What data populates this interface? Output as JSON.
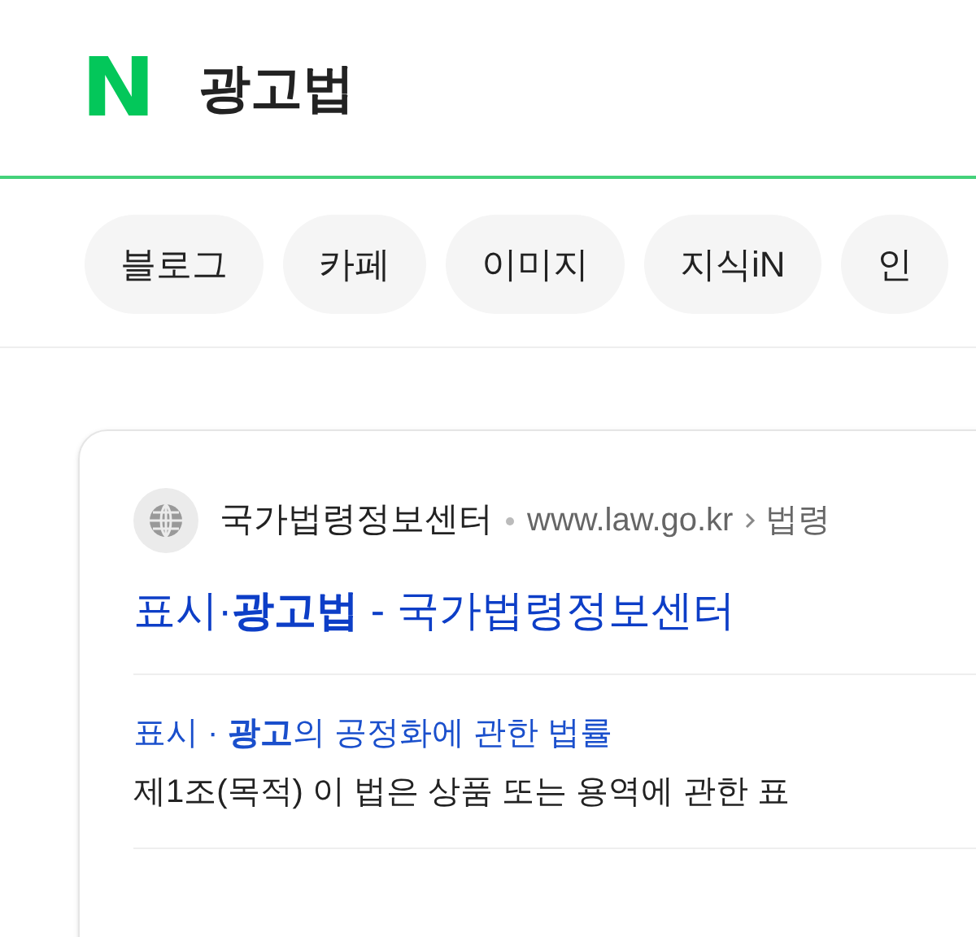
{
  "header": {
    "logo": "N",
    "query": "광고법"
  },
  "tabs": [
    {
      "label": "블로그",
      "selected": false
    },
    {
      "label": "카페",
      "selected": false
    },
    {
      "label": "이미지",
      "selected": false
    },
    {
      "label": "지식iN",
      "selected": false
    },
    {
      "label": "인",
      "selected": false
    }
  ],
  "result": {
    "site_name": "국가법령정보센터",
    "url": "www.law.go.kr",
    "breadcrumb": "법령",
    "title": "표시·**광고법** - 국가법령정보센터",
    "subtitle": "표시 · **광고**의 공정화에 관한 법률",
    "snippet": "제1조(목적) 이 법은 상품 또는 용역에 관한 표"
  }
}
